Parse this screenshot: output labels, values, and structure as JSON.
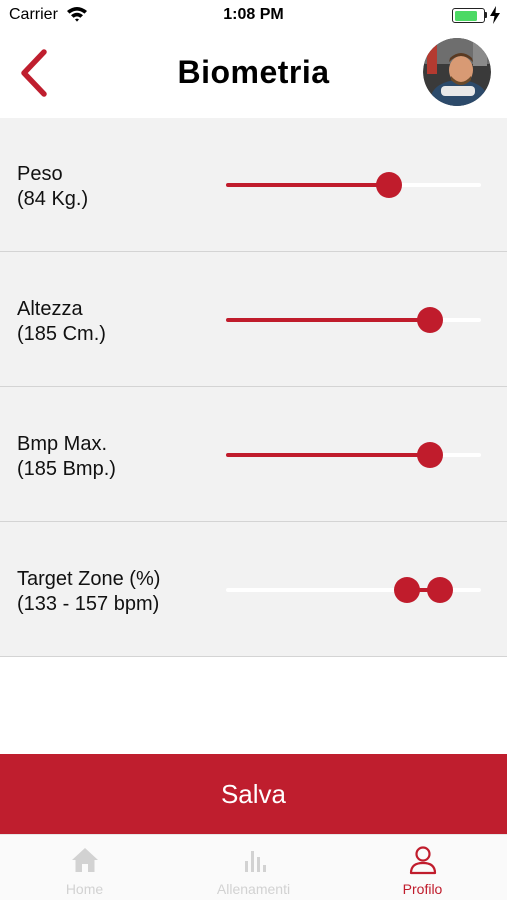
{
  "status_bar": {
    "carrier": "Carrier",
    "time": "1:08 PM",
    "battery_level": 0.8
  },
  "header": {
    "title": "Biometria",
    "back_icon": "chevron-left-icon",
    "avatar": "user-avatar"
  },
  "settings": [
    {
      "label": "Peso",
      "value_text": "(84 Kg.)",
      "fraction": 0.64
    },
    {
      "label": "Altezza",
      "value_text": "(185 Cm.)",
      "fraction": 0.8
    },
    {
      "label": "Bmp Max.",
      "value_text": "(185 Bmp.)",
      "fraction": 0.8
    },
    {
      "label": "Target Zone (%)",
      "value_text": "(133 - 157 bpm)",
      "range": [
        0.71,
        0.84
      ]
    }
  ],
  "save_label": "Salva",
  "tabs": [
    {
      "label": "Home",
      "icon": "home-icon",
      "active": false
    },
    {
      "label": "Allenamenti",
      "icon": "bar-chart-icon",
      "active": false
    },
    {
      "label": "Profilo",
      "icon": "person-icon",
      "active": true
    }
  ],
  "colors": {
    "accent": "#bf1e2e",
    "background": "#f2f2f2",
    "inactive_tab": "#d2d2d2"
  }
}
